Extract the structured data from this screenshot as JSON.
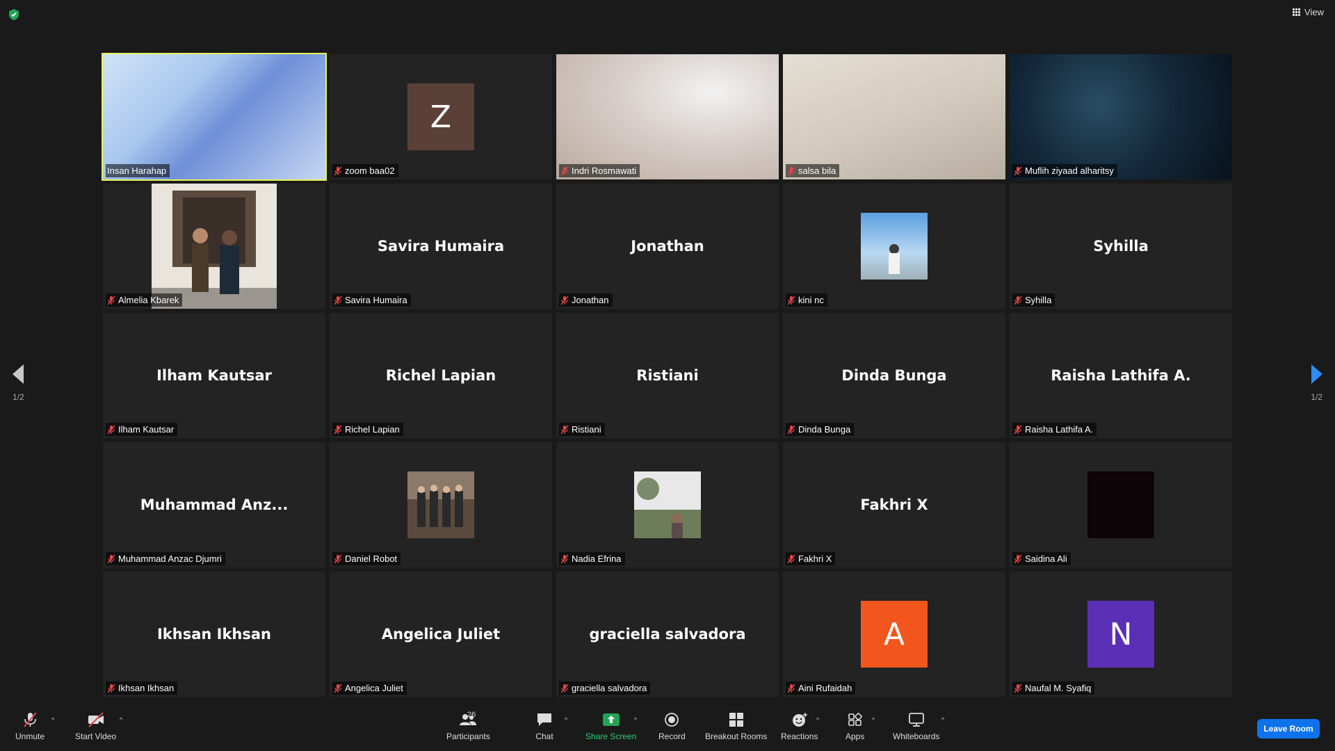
{
  "view": {
    "label": "View"
  },
  "pager": {
    "left_count": "1/2",
    "right_count": "1/2"
  },
  "tiles": [
    {
      "name": "Insan Harahap",
      "type": "video",
      "video": "v1",
      "active": true,
      "muted": false
    },
    {
      "name": "zoom baa02",
      "type": "avatar",
      "letter": "Z",
      "color": "#5b4038"
    },
    {
      "name": "Indri Rosmawati",
      "type": "video",
      "video": "v3"
    },
    {
      "name": "salsa bila",
      "type": "video",
      "video": "v4"
    },
    {
      "name": "Muflih ziyaad alharitsy",
      "type": "video",
      "video": "v5"
    },
    {
      "name": "Almelia Kbarek",
      "type": "photo-tall"
    },
    {
      "name": "Savira Humaira",
      "type": "text",
      "display": "Savira Humaira"
    },
    {
      "name": "Jonathan",
      "type": "text",
      "display": "Jonathan"
    },
    {
      "name": "kini nc",
      "type": "photo",
      "photo": "sky"
    },
    {
      "name": "Syhilla",
      "type": "text",
      "display": "Syhilla"
    },
    {
      "name": "Ilham Kautsar",
      "type": "text",
      "display": "Ilham Kautsar"
    },
    {
      "name": "Richel Lapian",
      "type": "text",
      "display": "Richel Lapian"
    },
    {
      "name": "Ristiani",
      "type": "text",
      "display": "Ristiani"
    },
    {
      "name": "Dinda Bunga",
      "type": "text",
      "display": "Dinda Bunga"
    },
    {
      "name": "Raisha Lathifa A.",
      "type": "text",
      "display": "Raisha Lathifa A."
    },
    {
      "name": "Muhammad Anzac Djumri",
      "type": "text",
      "display": "Muhammad  Anz..."
    },
    {
      "name": "Daniel Robot",
      "type": "photo",
      "photo": "group"
    },
    {
      "name": "Nadia Efrina",
      "type": "photo",
      "photo": "garden"
    },
    {
      "name": "Fakhri X",
      "type": "text",
      "display": "Fakhri X"
    },
    {
      "name": "Saidina Ali",
      "type": "photo",
      "photo": "black"
    },
    {
      "name": "Ikhsan Ikhsan",
      "type": "text",
      "display": "Ikhsan Ikhsan"
    },
    {
      "name": "Angelica Juliet",
      "type": "text",
      "display": "Angelica Juliet"
    },
    {
      "name": "graciella salvadora",
      "type": "text",
      "display": "graciella salvadora"
    },
    {
      "name": "Aini Rufaidah",
      "type": "avatar",
      "letter": "A",
      "color": "#f2561d"
    },
    {
      "name": "Naufal M. Syafiq",
      "type": "avatar",
      "letter": "N",
      "color": "#5b2fb5"
    }
  ],
  "toolbar": {
    "unmute": "Unmute",
    "start_video": "Start Video",
    "participants": "Participants",
    "participants_count": "26",
    "chat": "Chat",
    "share_screen": "Share Screen",
    "record": "Record",
    "breakout_rooms": "Breakout Rooms",
    "reactions": "Reactions",
    "apps": "Apps",
    "whiteboards": "Whiteboards",
    "leave": "Leave Room"
  },
  "colors": {
    "accent": "#2d8cff",
    "leave": "#0e72ed",
    "active_border": "#e6f25a",
    "share_green": "#2ecc71",
    "muted_red": "#e0474c"
  }
}
